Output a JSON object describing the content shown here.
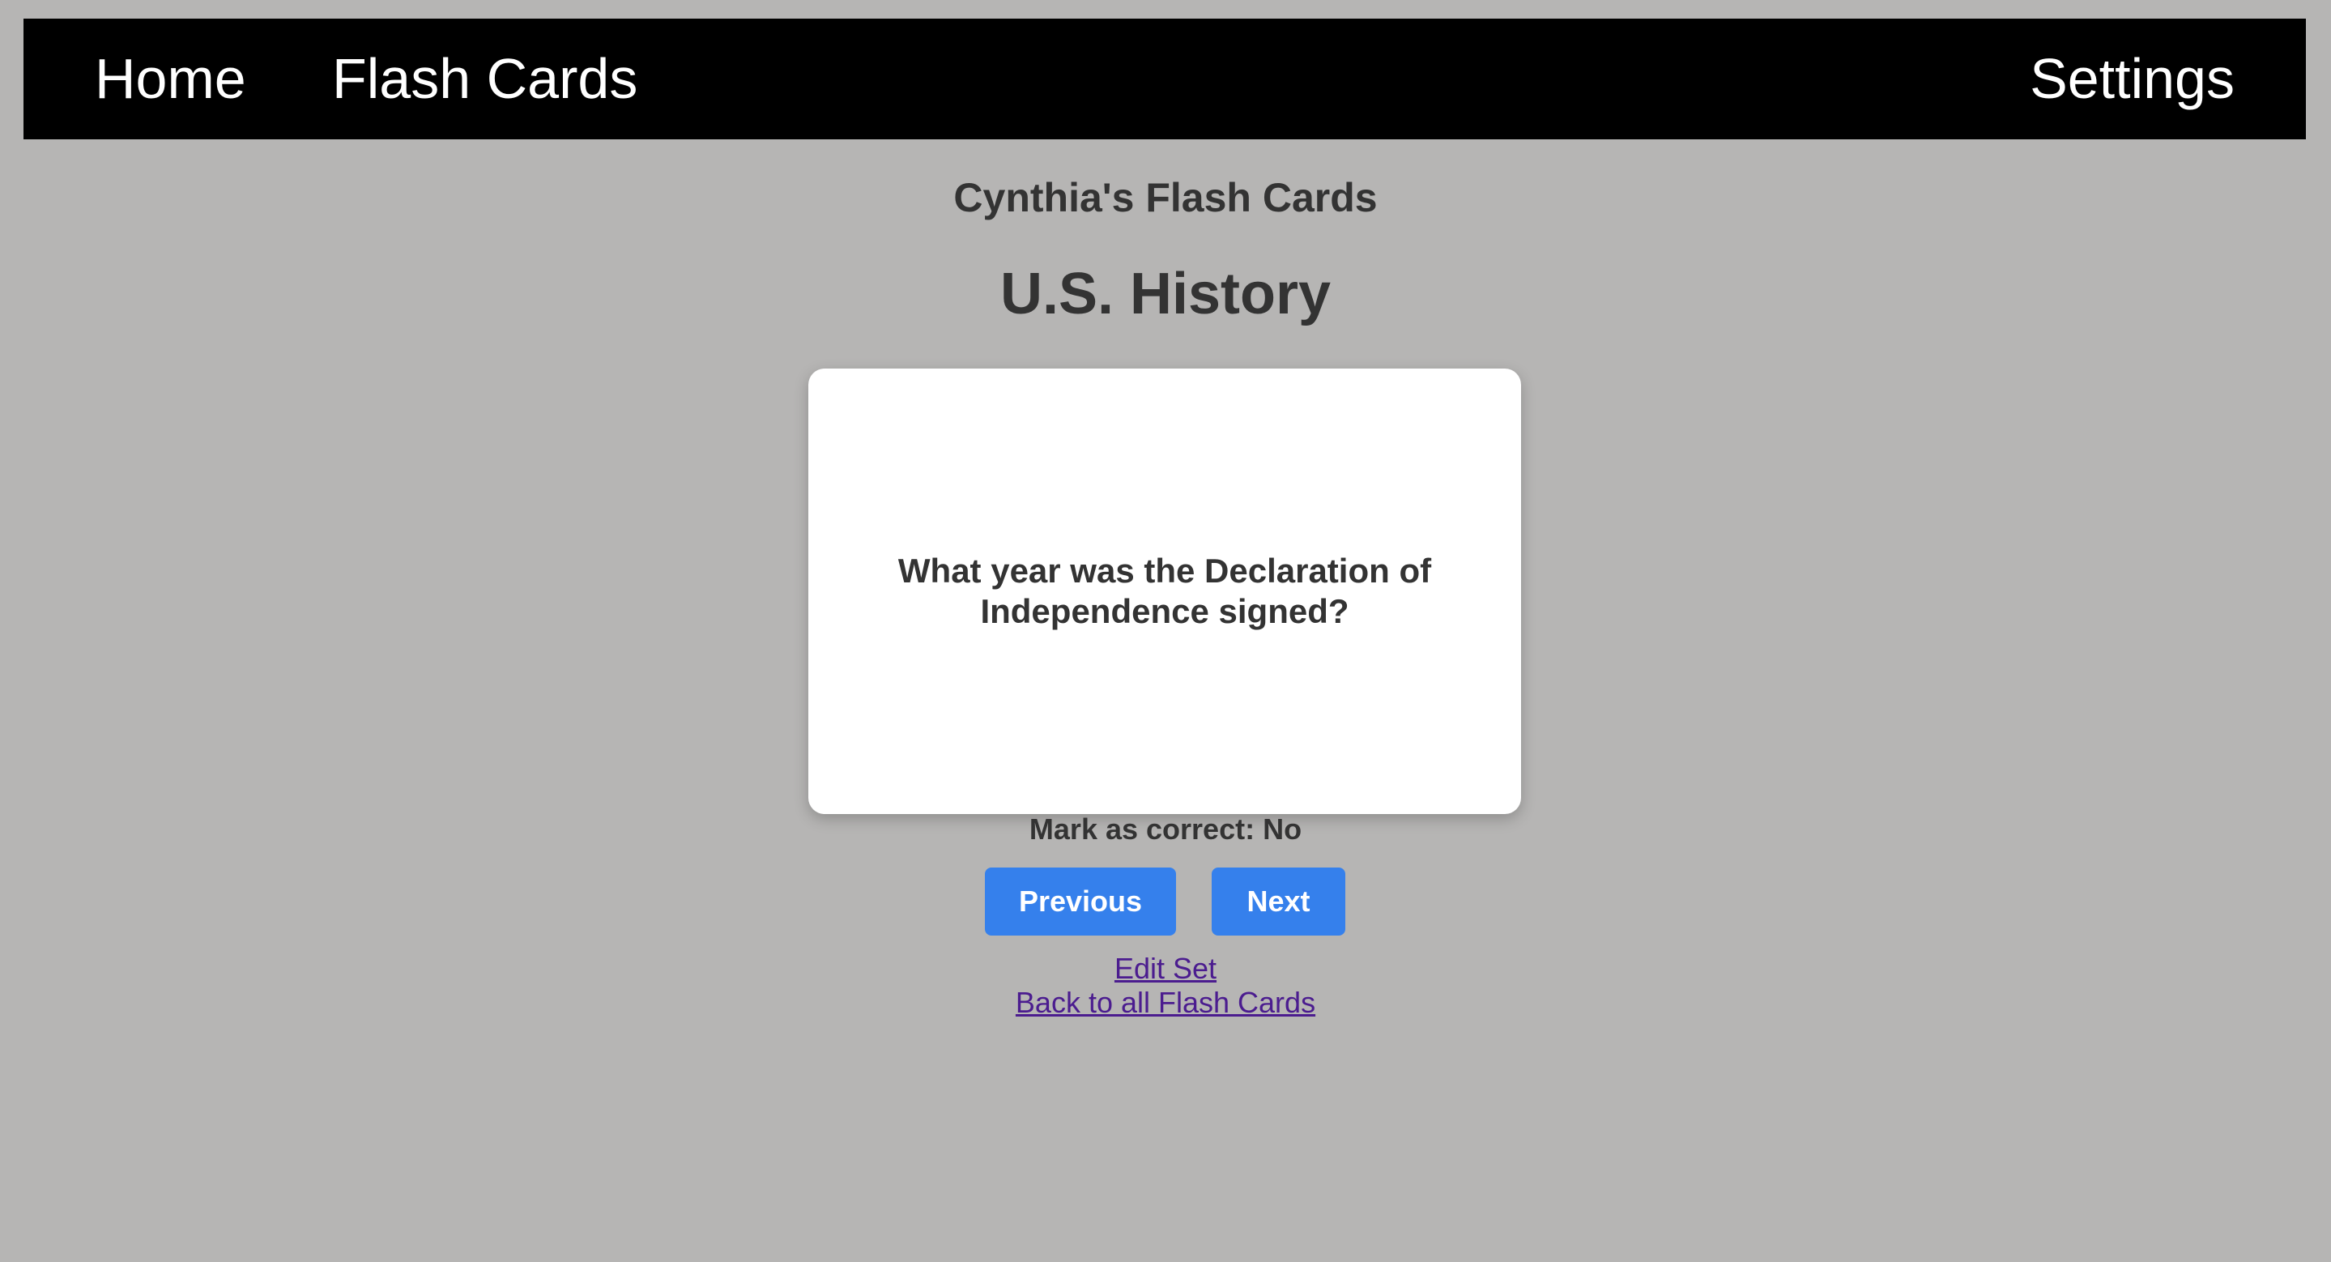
{
  "nav": {
    "home": "Home",
    "flash_cards": "Flash Cards",
    "settings": "Settings"
  },
  "set": {
    "owner_title": "Cynthia's Flash Cards",
    "name": "U.S. History"
  },
  "card": {
    "question": "What year was the Declaration of Independence signed?"
  },
  "mark": {
    "label": "Mark as correct:",
    "value": "No"
  },
  "buttons": {
    "previous": "Previous",
    "next": "Next"
  },
  "links": {
    "edit_set": "Edit Set",
    "back": "Back to all Flash Cards"
  },
  "colors": {
    "background": "#b6b5b4",
    "navbar": "#000000",
    "button": "#3580ec",
    "link": "#4b1c8f"
  }
}
